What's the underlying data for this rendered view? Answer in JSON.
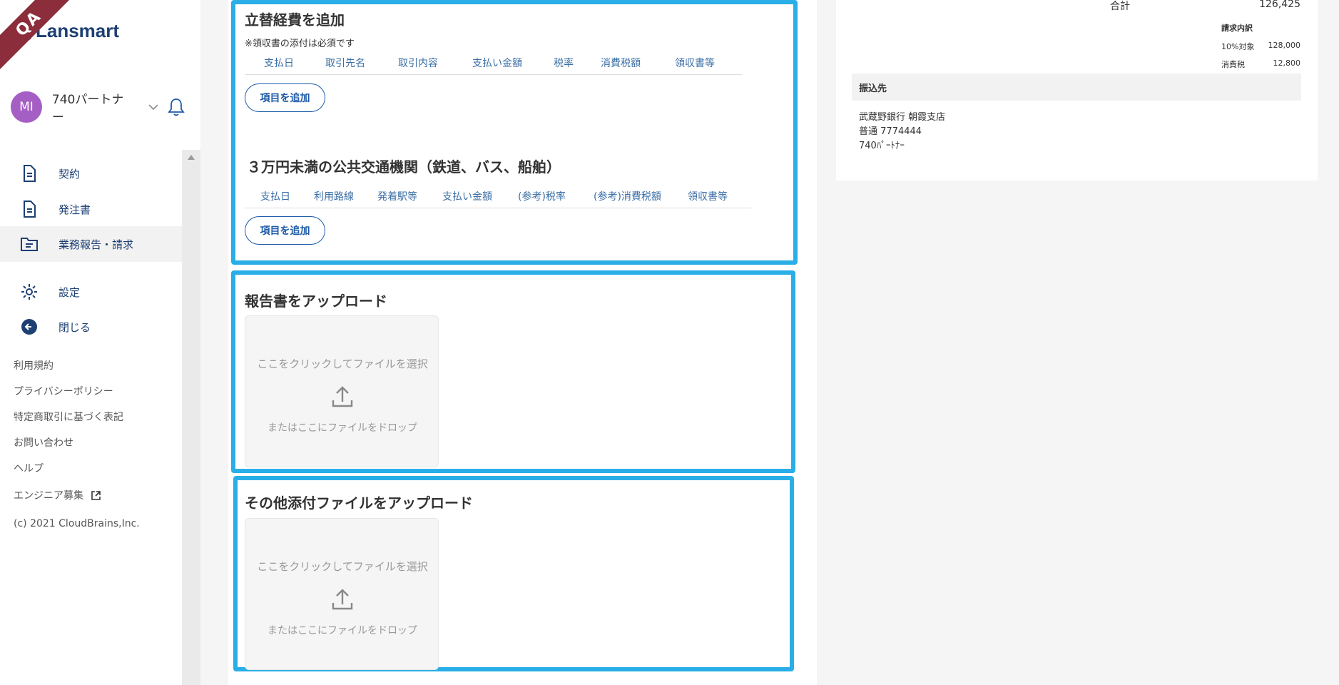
{
  "sidebar": {
    "qa_badge": "QA",
    "logo_text": "Lansmart",
    "user": {
      "initials": "MI",
      "name": "740パートナー"
    },
    "nav": [
      {
        "label": "契約",
        "icon": "document-icon"
      },
      {
        "label": "発注書",
        "icon": "document-icon"
      },
      {
        "label": "業務報告・請求",
        "icon": "folder-icon"
      },
      {
        "label": "設定",
        "icon": "gear-icon"
      },
      {
        "label": "閉じる",
        "icon": "arrow-left-circle-icon"
      }
    ],
    "footer_links": [
      "利用規約",
      "プライバシーポリシー",
      "特定商取引に基づく表記",
      "お問い合わせ",
      "ヘルプ",
      "エンジニア募集"
    ],
    "copyright": "(c) 2021 CloudBrains,Inc."
  },
  "expenses": {
    "title": "立替経費を追加",
    "note": "※領収書の添付は必須です",
    "columns": [
      "支払日",
      "取引先名",
      "取引内容",
      "支払い金額",
      "税率",
      "消費税額",
      "領収書等"
    ],
    "add_label": "項目を追加"
  },
  "transport": {
    "title": "３万円未満の公共交通機関（鉄道、バス、船舶）",
    "columns": [
      "支払日",
      "利用路線",
      "発着駅等",
      "支払い金額",
      "(参考)税率",
      "(参考)消費税額",
      "領収書等"
    ],
    "add_label": "項目を追加"
  },
  "report_upload": {
    "title": "報告書をアップロード",
    "click_text": "ここをクリックしてファイルを選択",
    "drop_text": "またはここにファイルをドロップ"
  },
  "other_upload": {
    "title": "その他添付ファイルをアップロード",
    "click_text": "ここをクリックしてファイルを選択",
    "drop_text": "またはここにファイルをドロップ"
  },
  "invoice": {
    "total_label": "合計",
    "total_value": "126,425",
    "breakdown_title": "請求内訳",
    "breakdown": [
      {
        "label": "10%対象",
        "value": "128,000"
      },
      {
        "label": "消費税",
        "value": "12,800"
      }
    ],
    "bank_title": "振込先",
    "bank_lines": [
      "武蔵野銀行 朝霞支店",
      "普通 7774444",
      "740ﾊﾟｰﾄﾅｰ"
    ]
  },
  "colors": {
    "accent_border": "#29aee8",
    "brand": "#1d3f73",
    "link_blue": "#3a6ea5"
  }
}
